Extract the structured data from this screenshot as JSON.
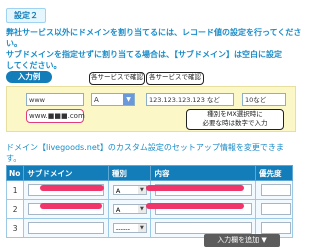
{
  "step_label": "設定２",
  "description": {
    "line1": "弊社サービス以外にドメインを割り当てるには、レコード値の設定を行ってくださ",
    "line2": "い。",
    "line3": "サブドメインを指定せずに割り当てる場合は、【サブドメイン】は空白に設定",
    "line4": "してください。"
  },
  "example": {
    "label": "入力例",
    "callout_type": "各サービスで確認",
    "callout_value": "各サービスで確認",
    "subdomain_value": "www",
    "type_value": "A",
    "content_value": "123.123.123.123 など",
    "priority_value": "10など",
    "mx_note_line1": "種別をMX選択時に",
    "mx_note_line2": "必要な時は数字で入力",
    "www_hint": "www.■■■.com"
  },
  "section": {
    "line1": "ドメイン【livegoods.net】のカスタム設定のセットアップ情報を変更できま",
    "line2": "す。"
  },
  "table": {
    "headers": [
      "No",
      "サブドメイン",
      "種別",
      "内容",
      "優先度"
    ],
    "rows": [
      {
        "no": "1",
        "type": "A"
      },
      {
        "no": "2",
        "type": "A"
      },
      {
        "no": "3",
        "type": "------"
      }
    ]
  },
  "add_button": "入力欄を追加 ▼",
  "colors": {
    "accent": "#127db8",
    "link_blue": "#1a8cc8",
    "redaction": "#f0356a",
    "example_bg": "#fbf7c7"
  }
}
